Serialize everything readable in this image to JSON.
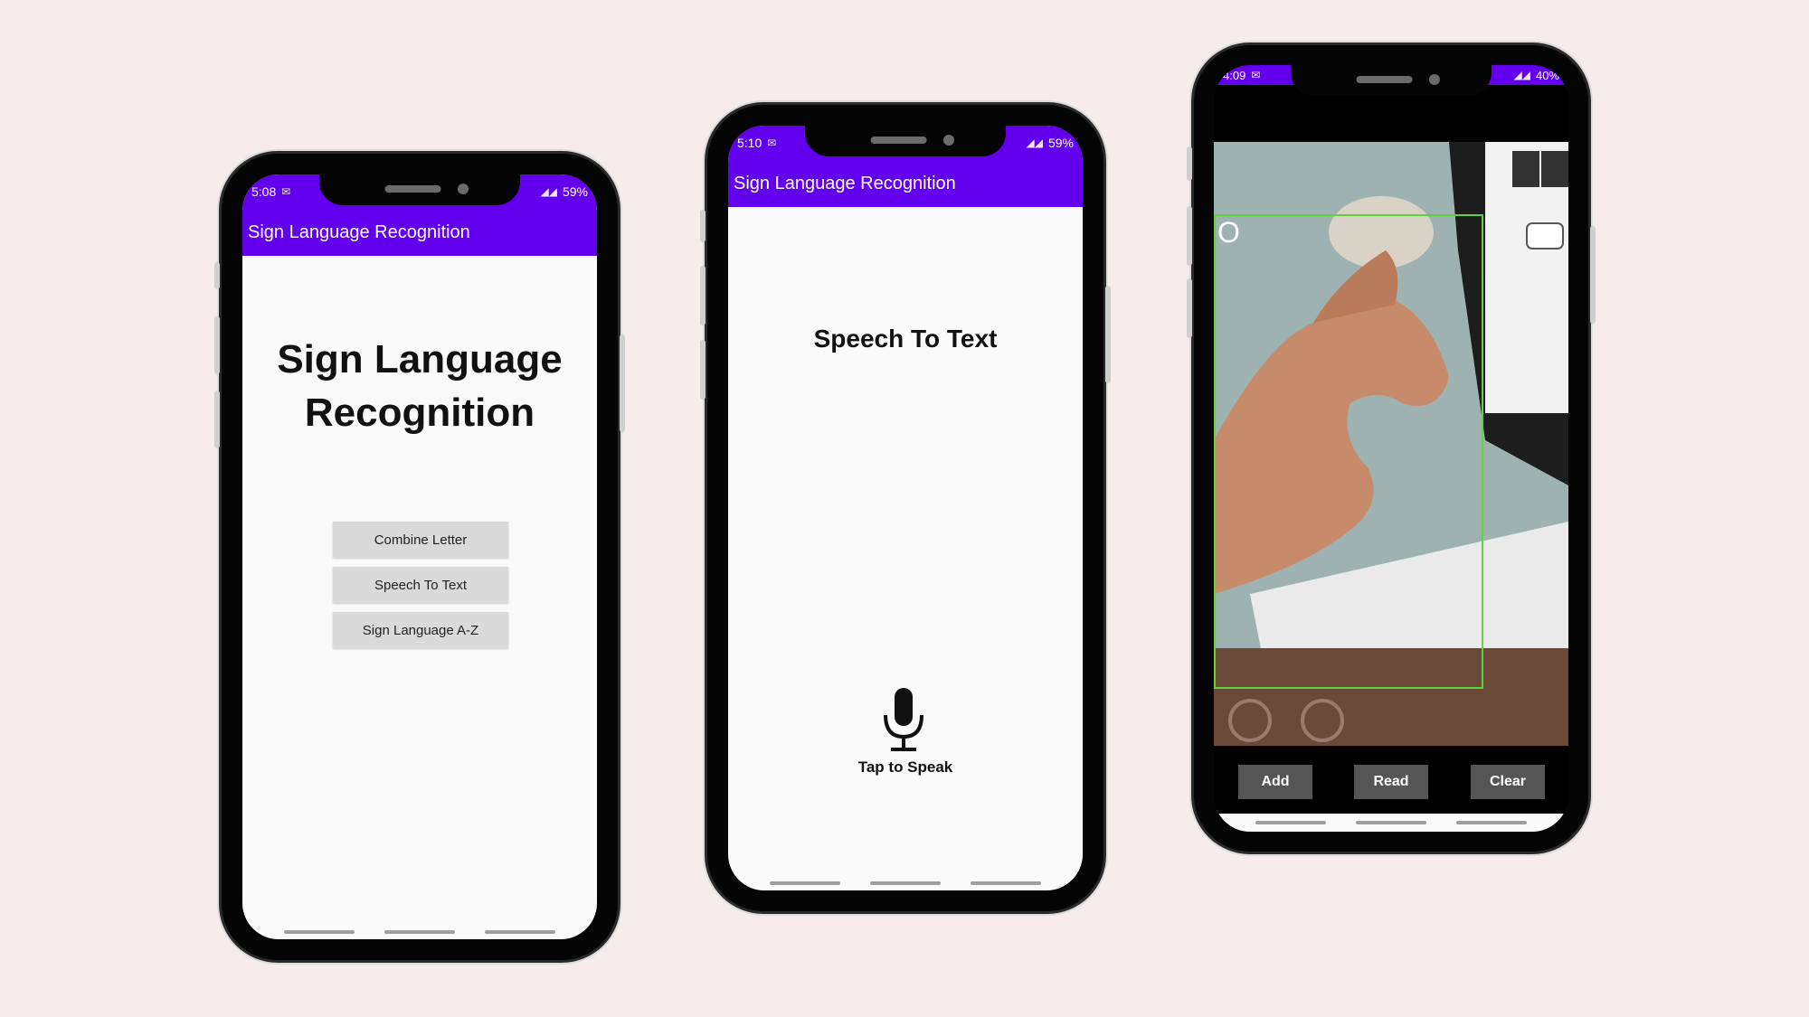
{
  "app_title": "Sign Language Recognition",
  "screens": [
    {
      "status": {
        "time": "5:08",
        "battery": "59%"
      },
      "appbar_title": "Sign Language Recognition",
      "main_title": "Sign Language Recognition",
      "buttons": [
        "Combine Letter",
        "Speech To Text",
        "Sign Language A-Z"
      ]
    },
    {
      "status": {
        "time": "5:10",
        "battery": "59%"
      },
      "appbar_title": "Sign Language Recognition",
      "heading": "Speech To Text",
      "mic_icon": "microphone-icon",
      "mic_label": "Tap to Speak"
    },
    {
      "status": {
        "time": "4:09",
        "battery": "40%"
      },
      "detected_text": "O",
      "buttons": [
        "Add",
        "Read",
        "Clear"
      ]
    }
  ],
  "colors": {
    "appbar": "#6200ee",
    "background": "#f6ecec",
    "button_gray": "#dadada",
    "camera_button": "#555555",
    "detection_box": "#5fd43a"
  }
}
